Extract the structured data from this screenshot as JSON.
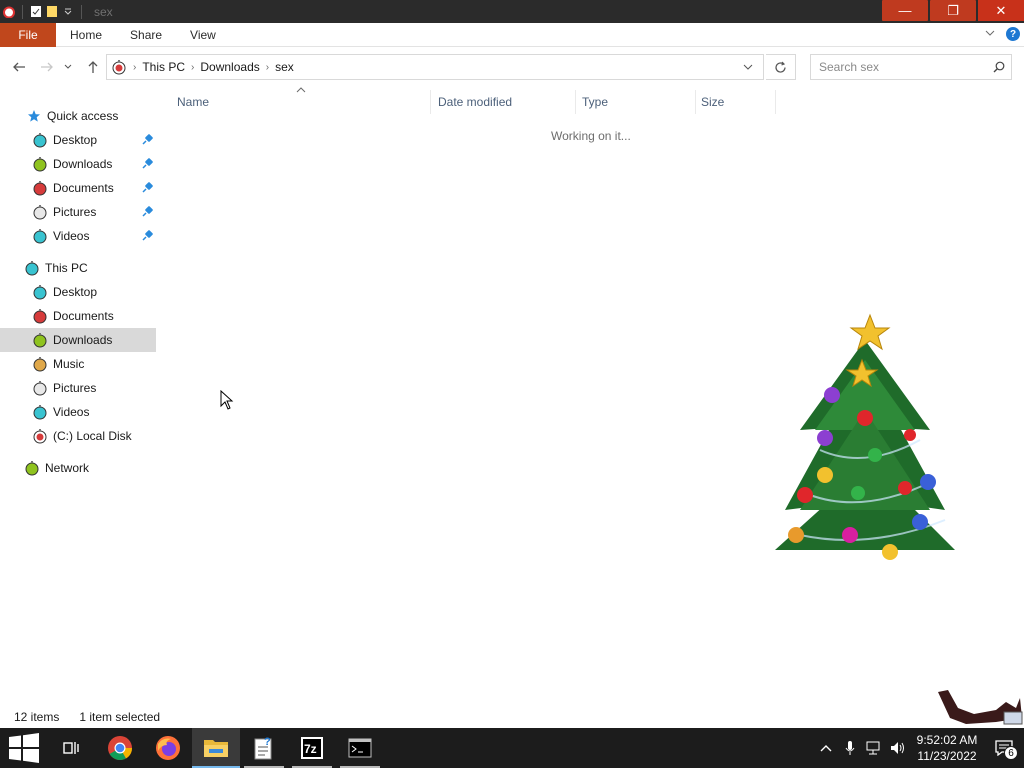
{
  "window": {
    "title": "sex",
    "controls": {
      "minimize": "—",
      "maximize": "❐",
      "close": "✕"
    }
  },
  "ribbon": {
    "tabs": [
      {
        "label": "File"
      },
      {
        "label": "Home"
      },
      {
        "label": "Share"
      },
      {
        "label": "View"
      }
    ]
  },
  "address": {
    "crumbs": [
      "This PC",
      "Downloads",
      "sex"
    ],
    "search_placeholder": "Search sex"
  },
  "nav": {
    "quick_access": {
      "label": "Quick access"
    },
    "quick_items": [
      {
        "label": "Desktop",
        "color": "#39c3d0"
      },
      {
        "label": "Downloads",
        "color": "#8fc31f"
      },
      {
        "label": "Documents",
        "color": "#d63b3b"
      },
      {
        "label": "Pictures",
        "color": "#e8e8e8"
      },
      {
        "label": "Videos",
        "color": "#39c3d0"
      }
    ],
    "this_pc": {
      "label": "This PC"
    },
    "pc_items": [
      {
        "label": "Desktop",
        "color": "#39c3d0"
      },
      {
        "label": "Documents",
        "color": "#d63b3b"
      },
      {
        "label": "Downloads",
        "color": "#8fc31f"
      },
      {
        "label": "Music",
        "color": "#e0a84a"
      },
      {
        "label": "Pictures",
        "color": "#e8e8e8"
      },
      {
        "label": "Videos",
        "color": "#39c3d0"
      },
      {
        "label": "(C:) Local Disk",
        "color": "#d63b3b"
      }
    ],
    "network": {
      "label": "Network"
    },
    "selected": "Downloads"
  },
  "content": {
    "columns": [
      "Name",
      "Date modified",
      "Type",
      "Size"
    ],
    "status_message": "Working on it..."
  },
  "statusbar": {
    "items_count": "12 items",
    "selection": "1 item selected"
  },
  "taskbar": {
    "apps": [
      {
        "name": "start",
        "icon": "windows-logo-icon"
      },
      {
        "name": "task-view",
        "icon": "task-view-icon"
      },
      {
        "name": "chrome",
        "icon": "chrome-icon"
      },
      {
        "name": "firefox",
        "icon": "firefox-icon"
      },
      {
        "name": "file-explorer",
        "icon": "folder-icon"
      },
      {
        "name": "help-doc",
        "icon": "help-document-icon"
      },
      {
        "name": "7zip",
        "icon": "7zip-icon",
        "label": "7z"
      },
      {
        "name": "terminal",
        "icon": "terminal-icon"
      }
    ],
    "clock": {
      "time": "9:52:02 AM",
      "date": "11/23/2022"
    },
    "notifications_count": "6"
  },
  "colors": {
    "file_tab": "#c0471c",
    "selection_bg": "#d9d9d9",
    "header_text": "#4c607a",
    "taskbar_bg": "#1c1c1c"
  }
}
